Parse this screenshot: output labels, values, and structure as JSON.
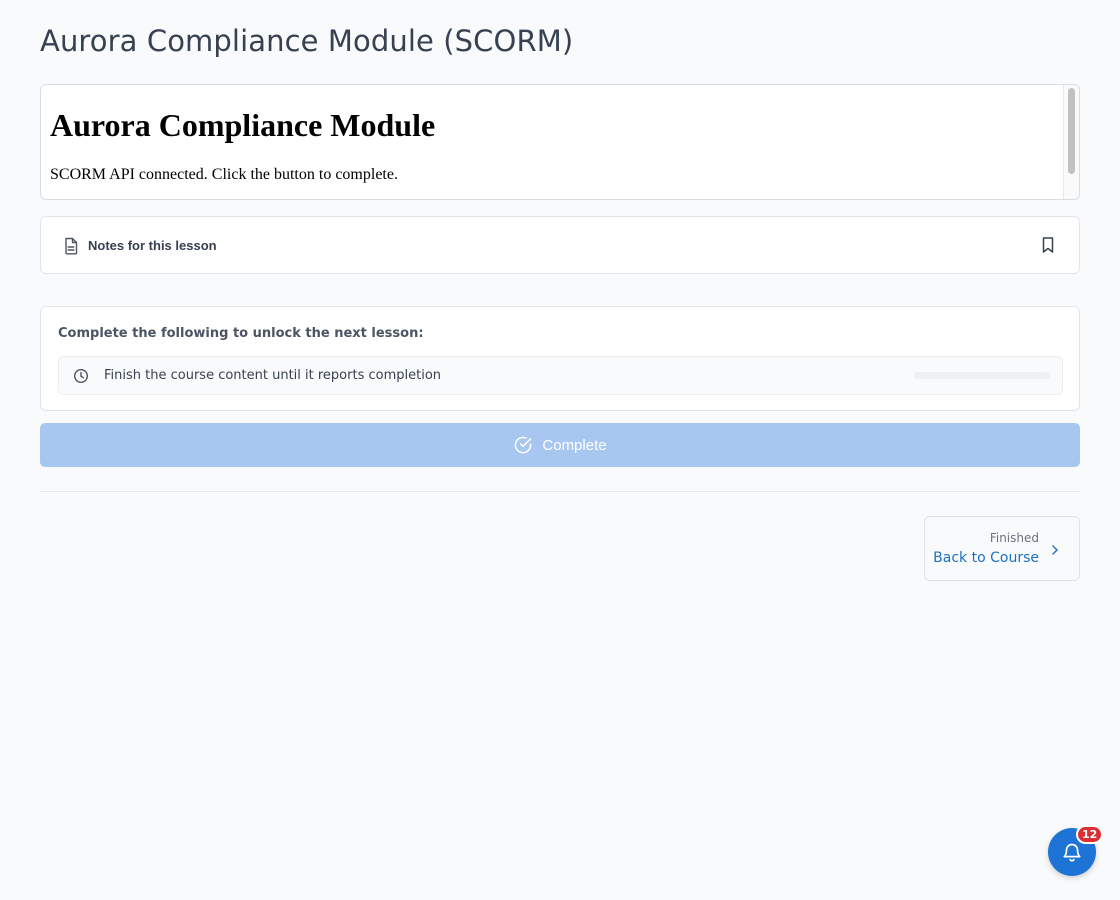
{
  "page": {
    "title": "Aurora Compliance Module (SCORM)"
  },
  "scorm": {
    "heading": "Aurora Compliance Module",
    "message": "SCORM API connected. Click the button to complete."
  },
  "notes": {
    "label": "Notes for this lesson",
    "icon": "document-icon",
    "bookmark_icon": "bookmark-icon"
  },
  "requirements": {
    "title": "Complete the following to unlock the next lesson:",
    "items": [
      {
        "text": "Finish the course content until it reports completion",
        "icon": "clock-icon",
        "progress_percent": 0
      }
    ]
  },
  "complete_button": {
    "label": "Complete",
    "icon": "check-circle-icon",
    "disabled": true
  },
  "next_nav": {
    "subtitle": "Finished",
    "label": "Back to Course",
    "icon": "chevron-right-icon"
  },
  "notifications": {
    "count": "12",
    "icon": "bell-icon"
  },
  "colors": {
    "background": "#f8fafc",
    "primary": "#1d74d6",
    "button_disabled": "#a7c7f0",
    "link": "#1e6fc4",
    "badge": "#dc2f34"
  }
}
